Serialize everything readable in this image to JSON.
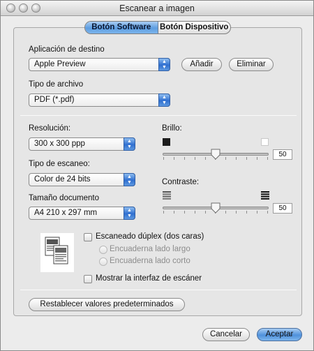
{
  "window": {
    "title": "Escanear a imagen"
  },
  "tabs": [
    {
      "label": "Botón Software",
      "active": true
    },
    {
      "label": "Botón Dispositivo",
      "active": false
    }
  ],
  "destination": {
    "label": "Aplicación de destino",
    "value": "Apple Preview",
    "add_label": "Añadir",
    "remove_label": "Eliminar"
  },
  "file_type": {
    "label": "Tipo de archivo",
    "value": "PDF (*.pdf)"
  },
  "resolution": {
    "label": "Resolución:",
    "value": "300 x 300 ppp"
  },
  "scan_type": {
    "label": "Tipo de escaneo:",
    "value": "Color de 24 bits"
  },
  "doc_size": {
    "label": "Tamaño documento",
    "value": "A4  210 x 297 mm"
  },
  "brightness": {
    "label": "Brillo:",
    "value": "50",
    "level": 0.5
  },
  "contrast": {
    "label": "Contraste:",
    "value": "50",
    "level": 0.5
  },
  "duplex": {
    "label": "Escaneado dúplex (dos caras)",
    "checked": false,
    "long_edge": "Encuaderna lado largo",
    "short_edge": "Encuaderna lado corto"
  },
  "show_interface": {
    "label": "Mostrar la interfaz de escáner",
    "checked": false
  },
  "reset_label": "Restablecer valores predeterminados",
  "cancel_label": "Cancelar",
  "accept_label": "Aceptar",
  "colors": {
    "accent": "#5d9de0",
    "window_bg": "#ececec"
  }
}
